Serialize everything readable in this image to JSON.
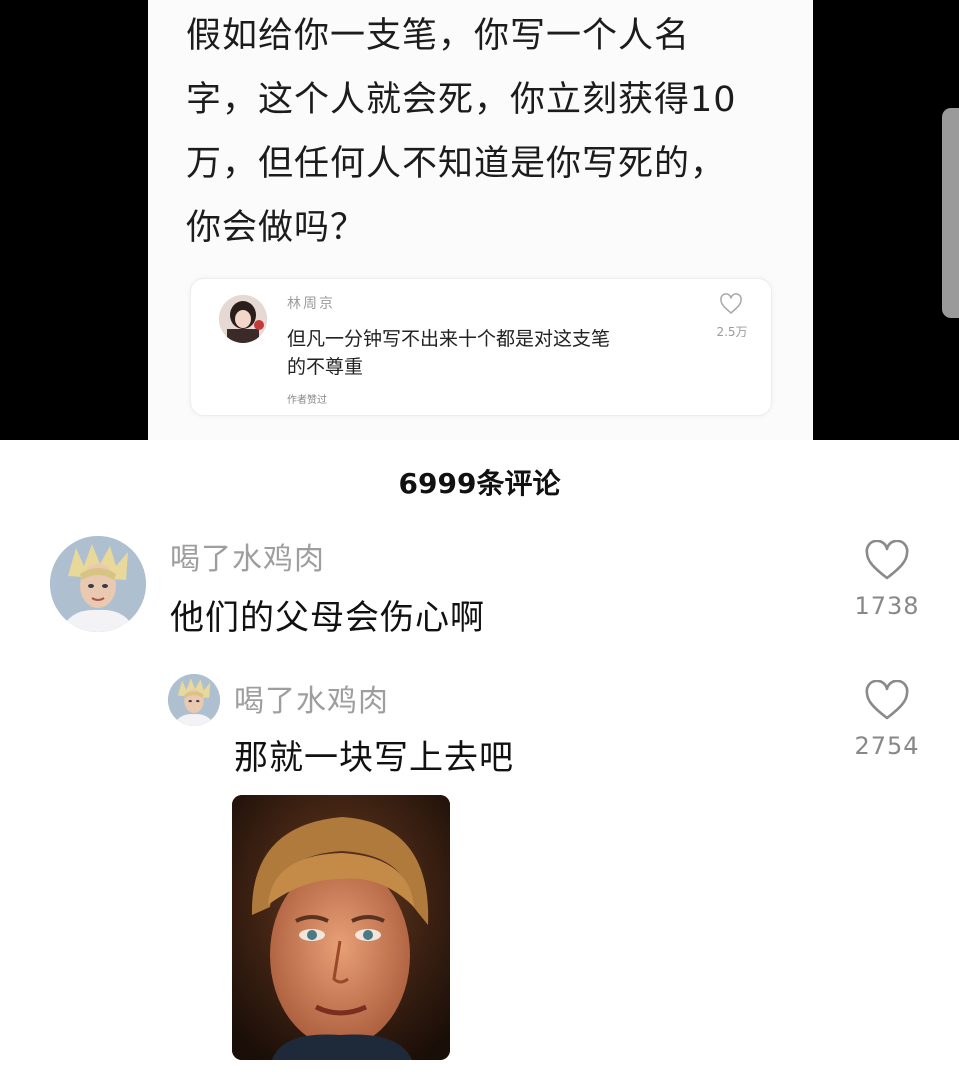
{
  "post": {
    "lines": [
      "假如给你一支笔，你写一个人名",
      "字，这个人就会死，你立刻获得10",
      "万，但任何人不知道是你写死的，",
      "你会做吗？"
    ]
  },
  "hot_comment": {
    "author": "林周京",
    "text_line1": "但凡一分钟写不出来十个都是对这支笔",
    "text_line2": "的不尊重",
    "badge": "作者赞过",
    "likes": "2.5万"
  },
  "comments_header": "6999条评论",
  "comments": [
    {
      "author": "喝了水鸡肉",
      "text": "他们的父母会伤心啊",
      "likes": "1738"
    },
    {
      "author": "喝了水鸡肉",
      "text": "那就一块写上去吧",
      "likes": "2754"
    }
  ],
  "icons": {
    "like": "heart-outline-icon"
  },
  "colors": {
    "muted_text": "#9e9e9e",
    "background": "#ffffff",
    "letterbox": "#000000"
  }
}
